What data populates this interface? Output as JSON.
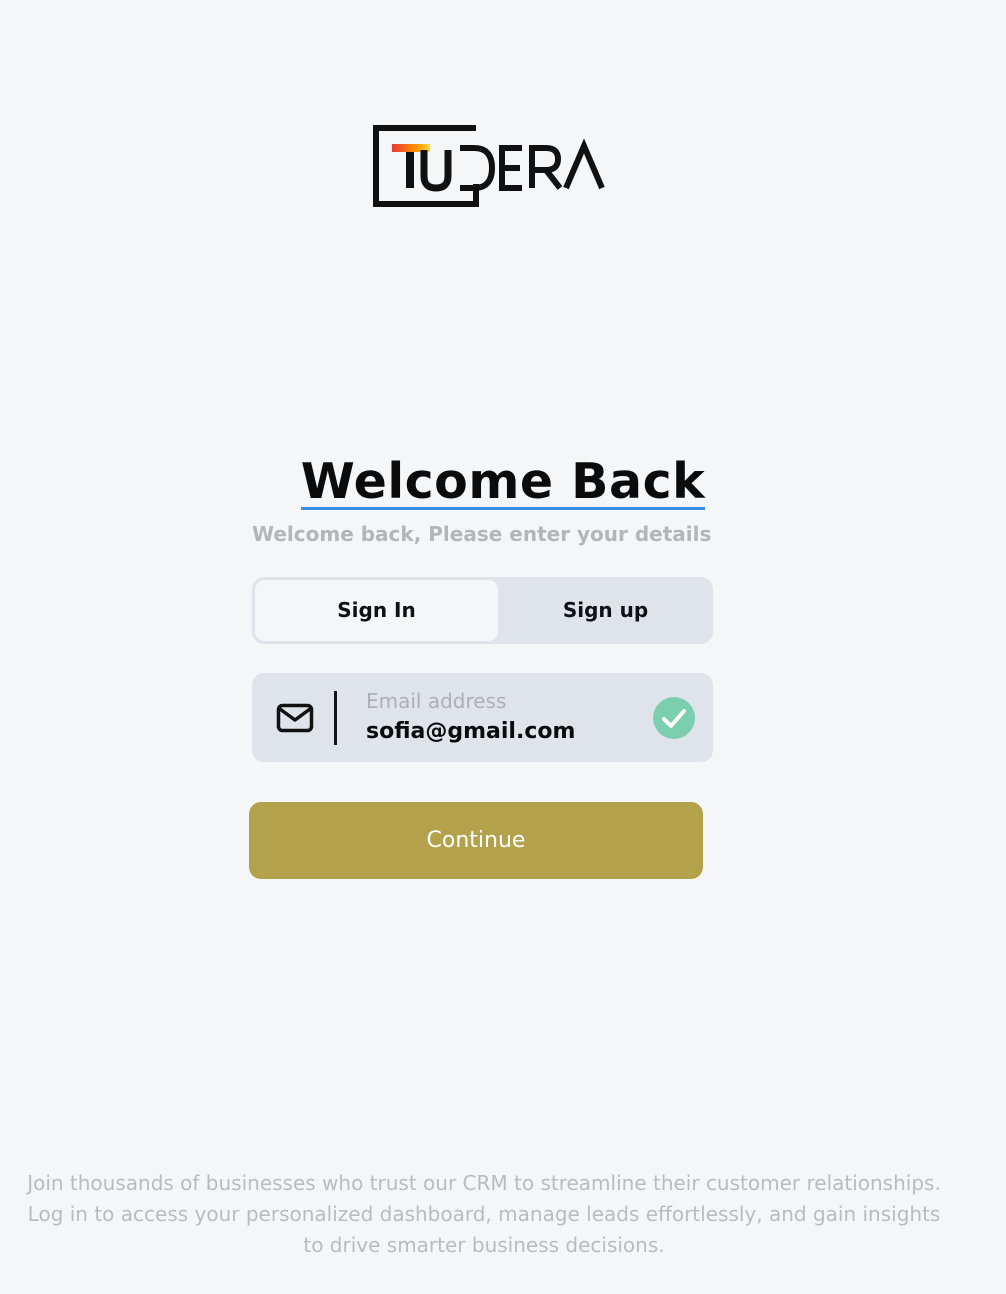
{
  "brand": {
    "logo_text": "TUDERA",
    "logo_accent_colors": [
      "#e53935",
      "#fb8c00",
      "#fdd835"
    ]
  },
  "header": {
    "title": "Welcome Back",
    "subtitle": "Welcome back, Please enter your details"
  },
  "tabs": [
    {
      "label": "Sign In",
      "active": true
    },
    {
      "label": "Sign up",
      "active": false
    }
  ],
  "email_field": {
    "icon": "mail-icon",
    "label": "Email address",
    "value": "sofia@gmail.com",
    "valid_icon": "check-circle-icon",
    "valid_color": "#7ccfae"
  },
  "continue_button": {
    "label": "Continue",
    "color": "#b3a24b"
  },
  "footer": {
    "text": "Join thousands of businesses who trust our CRM to streamline their customer relationships. Log in to access your personalized dashboard, manage leads effortlessly, and gain insights to drive smarter business decisions."
  }
}
